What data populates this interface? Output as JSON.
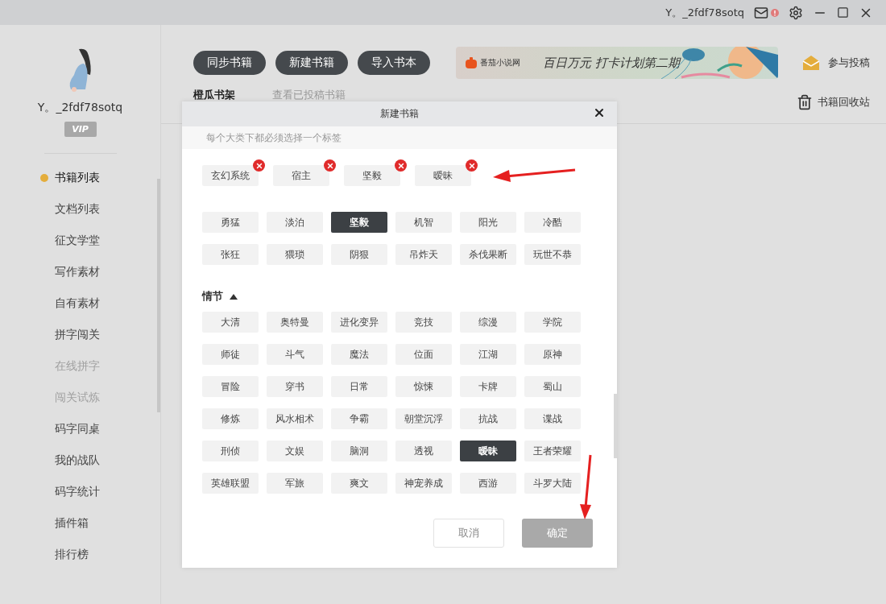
{
  "titlebar": {
    "username": "Y。_2fdf78sotq",
    "alert": true
  },
  "sidebar": {
    "username": "Y。_2fdf78sotq",
    "badge": "VIP",
    "items": [
      {
        "label": "书籍列表",
        "selected": true,
        "disabled": false
      },
      {
        "label": "文档列表",
        "selected": false,
        "disabled": false
      },
      {
        "label": "征文学堂",
        "selected": false,
        "disabled": false
      },
      {
        "label": "写作素材",
        "selected": false,
        "disabled": false
      },
      {
        "label": "自有素材",
        "selected": false,
        "disabled": false
      },
      {
        "label": "拼字闯关",
        "selected": false,
        "disabled": false
      },
      {
        "label": "在线拼字",
        "selected": false,
        "disabled": true
      },
      {
        "label": "闯关试炼",
        "selected": false,
        "disabled": true
      },
      {
        "label": "码字同桌",
        "selected": false,
        "disabled": false
      },
      {
        "label": "我的战队",
        "selected": false,
        "disabled": false
      },
      {
        "label": "码字统计",
        "selected": false,
        "disabled": false
      },
      {
        "label": "插件箱",
        "selected": false,
        "disabled": false
      },
      {
        "label": "排行榜",
        "selected": false,
        "disabled": false
      }
    ]
  },
  "toolbar": {
    "buttons": [
      "同步书籍",
      "新建书籍",
      "导入书本"
    ],
    "banner": {
      "brand": "番茄小说网",
      "text": "百日万元 打卡计划第二期"
    },
    "submit": "参与投稿"
  },
  "tabs": [
    {
      "label": "橙瓜书架",
      "selected": true
    },
    {
      "label": "查看已投稿书籍",
      "selected": false
    }
  ],
  "recycle": "书籍回收站",
  "dialog": {
    "title": "新建书籍",
    "hint": "每个大类下都必须选择一个标签",
    "chosen": [
      "玄幻系统",
      "宿主",
      "坚毅",
      "暧昧"
    ],
    "groups": [
      {
        "tags": [
          {
            "label": "勇猛",
            "selected": false
          },
          {
            "label": "淡泊",
            "selected": false
          },
          {
            "label": "坚毅",
            "selected": true
          },
          {
            "label": "机智",
            "selected": false
          },
          {
            "label": "阳光",
            "selected": false
          },
          {
            "label": "冷酷",
            "selected": false
          },
          {
            "label": "张狂",
            "selected": false
          },
          {
            "label": "猥琐",
            "selected": false
          },
          {
            "label": "阴狠",
            "selected": false
          },
          {
            "label": "吊炸天",
            "selected": false
          },
          {
            "label": "杀伐果断",
            "selected": false
          },
          {
            "label": "玩世不恭",
            "selected": false
          }
        ]
      },
      {
        "title": "情节",
        "expanded": true,
        "tags": [
          {
            "label": "大清",
            "selected": false
          },
          {
            "label": "奥特曼",
            "selected": false
          },
          {
            "label": "进化变异",
            "selected": false
          },
          {
            "label": "竞技",
            "selected": false
          },
          {
            "label": "综漫",
            "selected": false
          },
          {
            "label": "学院",
            "selected": false
          },
          {
            "label": "师徒",
            "selected": false
          },
          {
            "label": "斗气",
            "selected": false
          },
          {
            "label": "魔法",
            "selected": false
          },
          {
            "label": "位面",
            "selected": false
          },
          {
            "label": "江湖",
            "selected": false
          },
          {
            "label": "原神",
            "selected": false
          },
          {
            "label": "冒险",
            "selected": false
          },
          {
            "label": "穿书",
            "selected": false
          },
          {
            "label": "日常",
            "selected": false
          },
          {
            "label": "惊悚",
            "selected": false
          },
          {
            "label": "卡牌",
            "selected": false
          },
          {
            "label": "蜀山",
            "selected": false
          },
          {
            "label": "修炼",
            "selected": false
          },
          {
            "label": "风水相术",
            "selected": false
          },
          {
            "label": "争霸",
            "selected": false
          },
          {
            "label": "朝堂沉浮",
            "selected": false
          },
          {
            "label": "抗战",
            "selected": false
          },
          {
            "label": "谍战",
            "selected": false
          },
          {
            "label": "刑侦",
            "selected": false
          },
          {
            "label": "文娱",
            "selected": false
          },
          {
            "label": "脑洞",
            "selected": false
          },
          {
            "label": "透视",
            "selected": false
          },
          {
            "label": "暧昧",
            "selected": true
          },
          {
            "label": "王者荣耀",
            "selected": false
          },
          {
            "label": "英雄联盟",
            "selected": false
          },
          {
            "label": "军旅",
            "selected": false
          },
          {
            "label": "爽文",
            "selected": false
          },
          {
            "label": "神宠养成",
            "selected": false
          },
          {
            "label": "西游",
            "selected": false
          },
          {
            "label": "斗罗大陆",
            "selected": false
          }
        ]
      }
    ],
    "buttons": [
      {
        "label": "取消",
        "kind": "secondary"
      },
      {
        "label": "确定",
        "kind": "primary"
      }
    ]
  }
}
